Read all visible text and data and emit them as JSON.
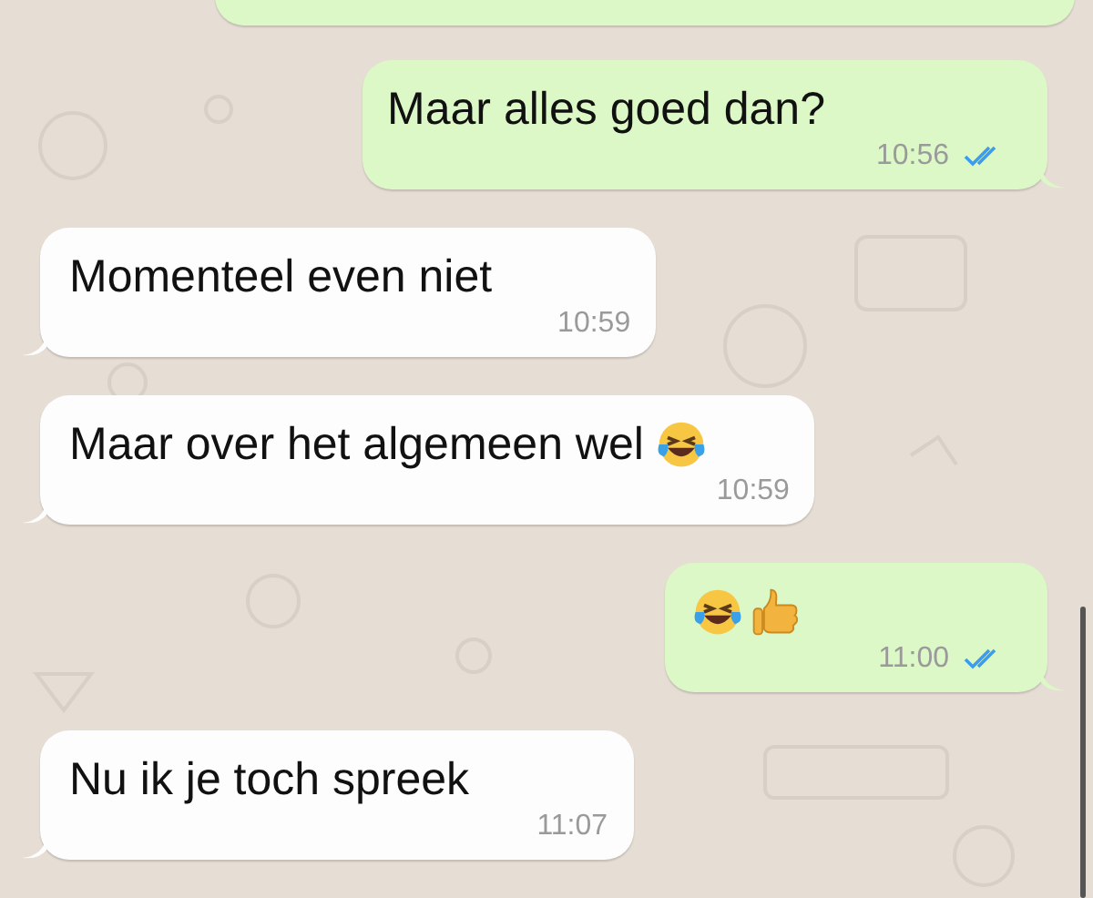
{
  "messages": [
    {
      "outgoing": true,
      "kind": "cut_off"
    },
    {
      "outgoing": true,
      "kind": "text",
      "text": "Maar alles goed dan?",
      "time": "10:56",
      "read": true
    },
    {
      "outgoing": false,
      "kind": "text",
      "text": "Momenteel even niet",
      "time": "10:59"
    },
    {
      "outgoing": false,
      "kind": "text",
      "text": "Maar over het algemeen wel",
      "time": "10:59",
      "emoji": [
        {
          "kind": "laughing"
        }
      ]
    },
    {
      "outgoing": true,
      "kind": "emoji_only",
      "time": "11:00",
      "read": true,
      "emoji": [
        {
          "kind": "laughing"
        },
        {
          "kind": "thumbs_up"
        }
      ]
    },
    {
      "outgoing": false,
      "kind": "text",
      "text": "Nu ik je toch spreek",
      "time": "11:07"
    }
  ]
}
